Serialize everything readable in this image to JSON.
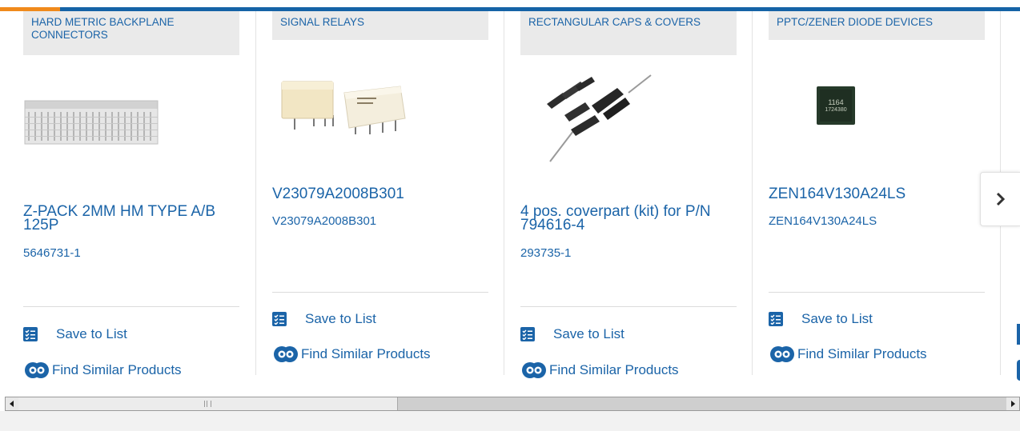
{
  "cards": [
    {
      "category": "HARD METRIC BACKPLANE CONNECTORS",
      "title": "Z-PACK 2MM HM TYPE A/B 125P",
      "part_number": "5646731-1",
      "save_label": "Save to List",
      "similar_label": "Find Similar Products"
    },
    {
      "category": "SIGNAL RELAYS",
      "title": "V23079A2008B301",
      "part_number": "V23079A2008B301",
      "save_label": "Save to List",
      "similar_label": "Find Similar Products"
    },
    {
      "category": "RECTANGULAR CAPS & COVERS",
      "title": "4 pos. coverpart (kit) for P/N 794616-4",
      "part_number": "293735-1",
      "save_label": "Save to List",
      "similar_label": "Find Similar Products"
    },
    {
      "category": "PPTC/ZENER DIODE DEVICES",
      "title": "ZEN164V130A24LS",
      "part_number": "ZEN164V130A24LS",
      "save_label": "Save to List",
      "similar_label": "Find Similar Products"
    }
  ],
  "chip_marking": {
    "line1": "1164",
    "line2": "1724380"
  },
  "carousel": {
    "next_icon": "chevron-right-icon"
  },
  "colors": {
    "link": "#1b64a8",
    "accent": "#f08a1c",
    "bar": "#1563a6",
    "category_bg": "#eaeaea"
  },
  "scrollbar": {
    "position_fraction": 0.0,
    "visible_fraction": 0.37
  }
}
